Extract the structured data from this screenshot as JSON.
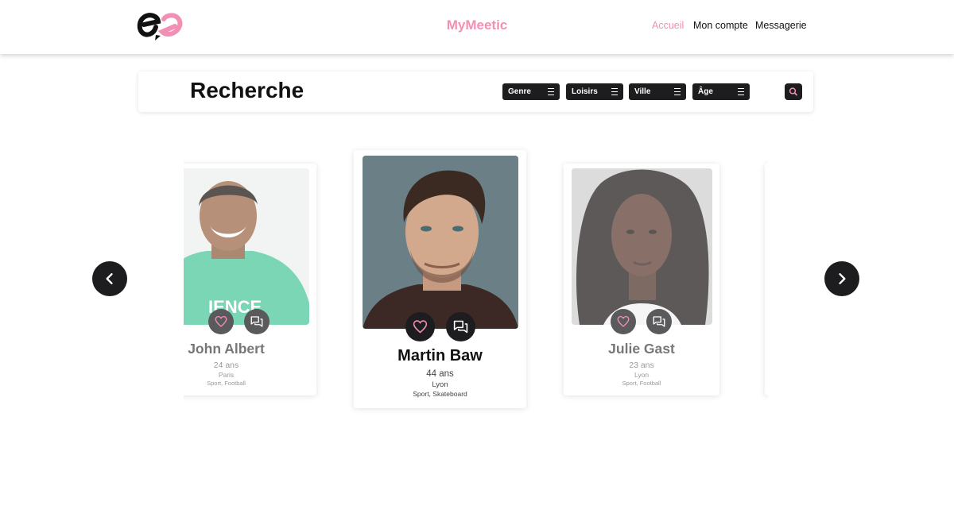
{
  "header": {
    "brand": "MyMeetic",
    "nav": [
      "Accueil",
      "Mon compte",
      "Messagerie"
    ],
    "active_color": "#f28fb5"
  },
  "search": {
    "title": "Recherche",
    "filters": [
      "Genre",
      "Loisirs",
      "Ville",
      "Âge"
    ]
  },
  "profiles": [
    {
      "name": "John Albert",
      "age": "24 ans",
      "city": "Paris",
      "hobbies": "Sport, Football"
    },
    {
      "name": "Martin Baw",
      "age": "44 ans",
      "city": "Lyon",
      "hobbies": "Sport, Skateboard"
    },
    {
      "name": "Julie Gast",
      "age": "23 ans",
      "city": "Lyon",
      "hobbies": "Sport, Football"
    }
  ],
  "icons": {
    "logo": "two-heart-e-logo",
    "like": "heart-icon",
    "message": "chat-icon",
    "search": "search-icon",
    "prev": "chevron-left-icon",
    "next": "chevron-right-icon",
    "filter": "menu-lines-icon"
  }
}
